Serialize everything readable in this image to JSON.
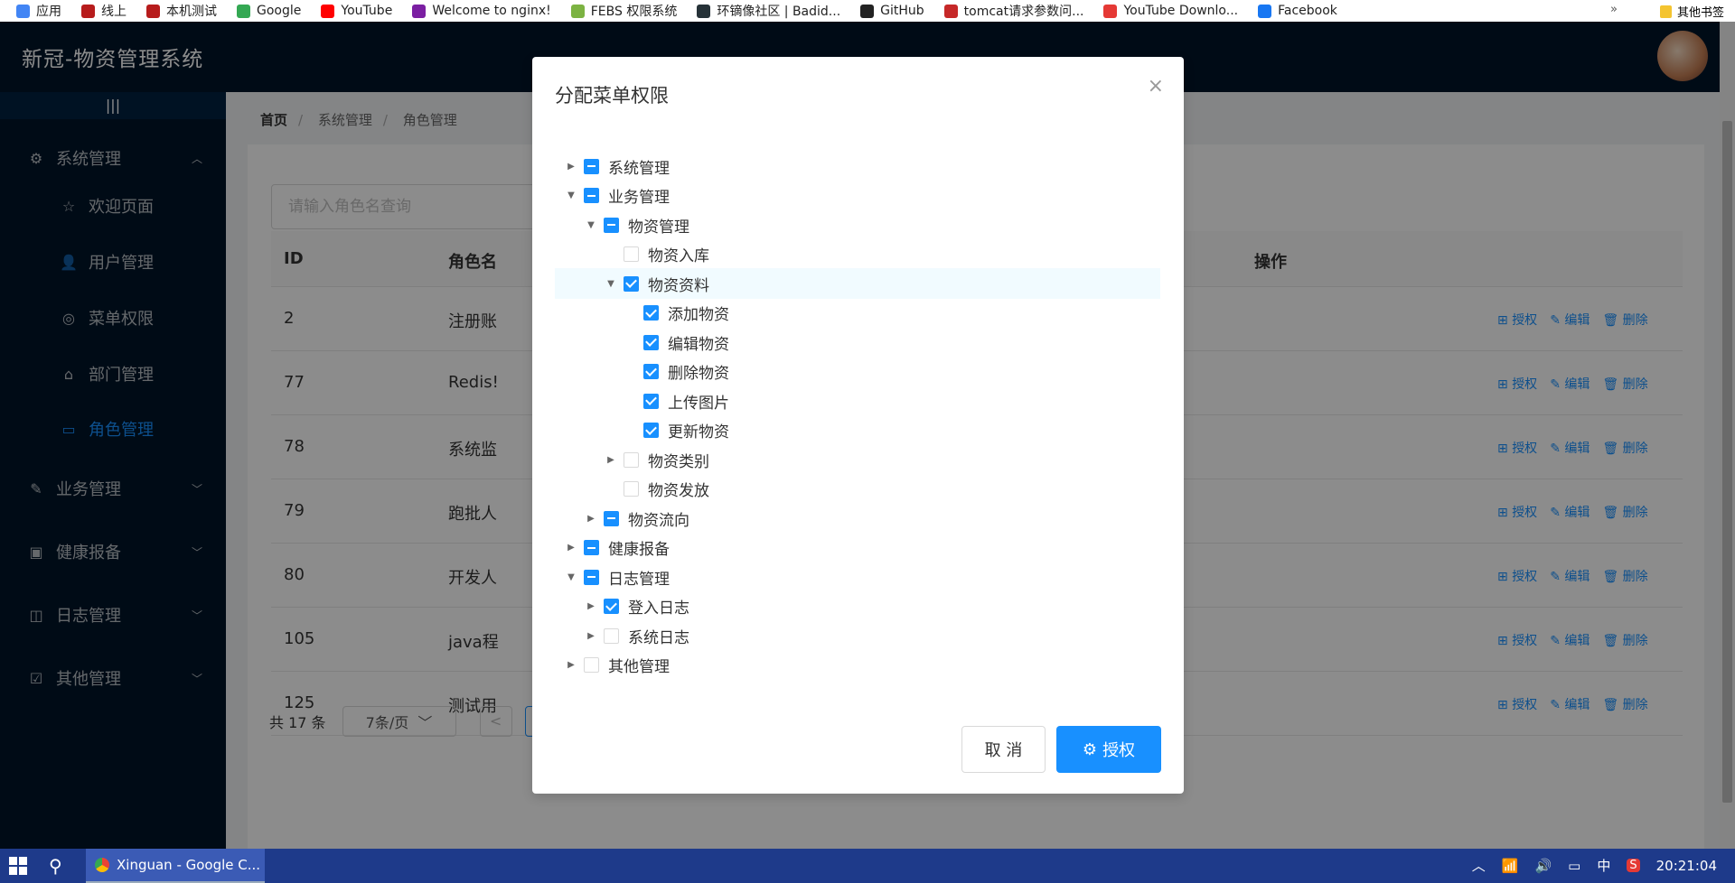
{
  "bookmarks": [
    {
      "label": "应用",
      "color": "#4285f4"
    },
    {
      "label": "线上",
      "color": "#b71c1c"
    },
    {
      "label": "本机测试",
      "color": "#b71c1c"
    },
    {
      "label": "Google",
      "color": "#34a853"
    },
    {
      "label": "YouTube",
      "color": "#ff0000"
    },
    {
      "label": "Welcome to nginx!",
      "color": "#7b1fa2"
    },
    {
      "label": "FEBS 权限系统",
      "color": "#7cb342"
    },
    {
      "label": "环镝像社区 | Badid...",
      "color": "#263238"
    },
    {
      "label": "GitHub",
      "color": "#222222"
    },
    {
      "label": "tomcat请求参数问...",
      "color": "#c62828"
    },
    {
      "label": "YouTube Downlo...",
      "color": "#e53935"
    },
    {
      "label": "Facebook",
      "color": "#1877f2"
    }
  ],
  "bookmarks_more": "»",
  "bookmarks_other": "其他书签",
  "app": {
    "title": "新冠-物资管理系统"
  },
  "sidebar": {
    "collapse": "|||",
    "items": [
      {
        "label": "系统管理",
        "icon": "gear-icon",
        "glyph": "⚙",
        "arrow": "︿"
      },
      {
        "label": "欢迎页面",
        "icon": "star-icon",
        "glyph": "☆"
      },
      {
        "label": "用户管理",
        "icon": "user-icon",
        "glyph": "👤"
      },
      {
        "label": "菜单权限",
        "icon": "menu-icon",
        "glyph": "◎"
      },
      {
        "label": "部门管理",
        "icon": "home-icon",
        "glyph": "⌂"
      },
      {
        "label": "角色管理",
        "icon": "role-icon",
        "glyph": "▭"
      },
      {
        "label": "业务管理",
        "icon": "edit-icon",
        "glyph": "✎",
        "arrow": "﹀"
      },
      {
        "label": "健康报备",
        "icon": "health-icon",
        "glyph": "▣",
        "arrow": "﹀"
      },
      {
        "label": "日志管理",
        "icon": "camera-icon",
        "glyph": "◫",
        "arrow": "﹀"
      },
      {
        "label": "其他管理",
        "icon": "check-icon",
        "glyph": "☑",
        "arrow": "﹀"
      }
    ]
  },
  "breadcrumb": [
    "首页",
    "系统管理",
    "角色管理"
  ],
  "search": {
    "placeholder": "请输入角色名查询"
  },
  "table": {
    "headers": [
      "ID",
      "角色名",
      "操作"
    ],
    "rows": [
      {
        "id": "2",
        "name": "注册账"
      },
      {
        "id": "77",
        "name": "Redis!"
      },
      {
        "id": "78",
        "name": "系统监"
      },
      {
        "id": "79",
        "name": "跑批人"
      },
      {
        "id": "80",
        "name": "开发人"
      },
      {
        "id": "105",
        "name": "java程"
      },
      {
        "id": "125",
        "name": "测试用"
      }
    ],
    "actions": [
      "授权",
      "编辑",
      "删除"
    ]
  },
  "pager": {
    "total": "共 17 条",
    "page_size": "7条/页",
    "prev": "<"
  },
  "modal": {
    "title": "分配菜单权限",
    "close": "×",
    "tree": [
      {
        "label": "系统管理",
        "level": 0,
        "switch": "▶",
        "state": "partial"
      },
      {
        "label": "业务管理",
        "level": 0,
        "switch": "▼",
        "state": "partial"
      },
      {
        "label": "物资管理",
        "level": 1,
        "switch": "▼",
        "state": "partial"
      },
      {
        "label": "物资入库",
        "level": 2,
        "switch": "",
        "state": "unchecked"
      },
      {
        "label": "物资资料",
        "level": 2,
        "switch": "▼",
        "state": "checked"
      },
      {
        "label": "添加物资",
        "level": 3,
        "switch": "",
        "state": "checked"
      },
      {
        "label": "编辑物资",
        "level": 3,
        "switch": "",
        "state": "checked"
      },
      {
        "label": "删除物资",
        "level": 3,
        "switch": "",
        "state": "checked"
      },
      {
        "label": "上传图片",
        "level": 3,
        "switch": "",
        "state": "checked"
      },
      {
        "label": "更新物资",
        "level": 3,
        "switch": "",
        "state": "checked"
      },
      {
        "label": "物资类别",
        "level": 2,
        "switch": "▶",
        "state": "unchecked"
      },
      {
        "label": "物资发放",
        "level": 2,
        "switch": "",
        "state": "unchecked"
      },
      {
        "label": "物资流向",
        "level": 1,
        "switch": "▶",
        "state": "partial"
      },
      {
        "label": "健康报备",
        "level": 0,
        "switch": "▶",
        "state": "partial"
      },
      {
        "label": "日志管理",
        "level": 0,
        "switch": "▼",
        "state": "partial"
      },
      {
        "label": "登入日志",
        "level": 1,
        "switch": "▶",
        "state": "checked"
      },
      {
        "label": "系统日志",
        "level": 1,
        "switch": "▶",
        "state": "unchecked"
      },
      {
        "label": "其他管理",
        "level": 0,
        "switch": "▶",
        "state": "unchecked"
      }
    ],
    "cancel": "取 消",
    "ok": "授权",
    "ok_icon": "⚙"
  },
  "taskbar": {
    "app": "Xinguan - Google C...",
    "time": "20:21:04",
    "ime": "中",
    "tray_icons": [
      "︿",
      "📶",
      "🔊",
      "▭"
    ]
  },
  "colors": {
    "primary": "#1890ff",
    "sidebar": "#001529",
    "taskbar": "#1e3a8a"
  }
}
